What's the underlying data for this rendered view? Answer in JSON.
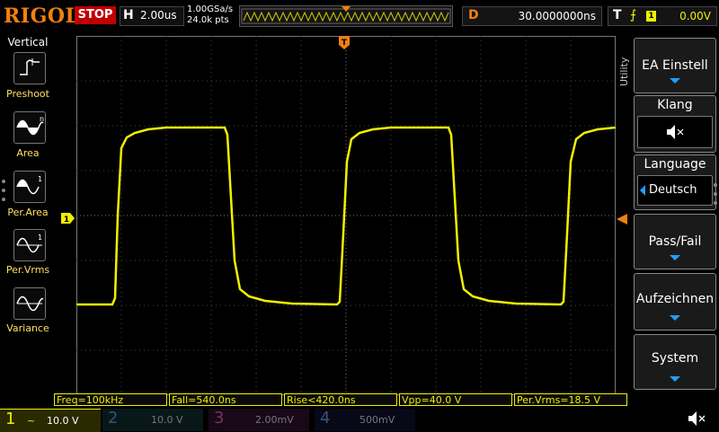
{
  "brand": "RIGOL",
  "run_state": "STOP",
  "horizontal": {
    "key": "H",
    "timebase": "2.00us"
  },
  "acquisition": {
    "sample_rate": "1.00GSa/s",
    "points": "24.0k pts"
  },
  "delay": {
    "key": "D",
    "value": "30.0000000ns"
  },
  "trigger": {
    "key": "T",
    "edge": "⨍",
    "source": "1",
    "level": "0.00V"
  },
  "markers": {
    "trigger_top": "T",
    "ch1_marker": "1"
  },
  "left_menu": {
    "title": "Vertical",
    "items": [
      {
        "label": "Preshoot",
        "icon": "preshoot-icon"
      },
      {
        "label": "Area",
        "icon": "area-icon"
      },
      {
        "label": "Per.Area",
        "icon": "per-area-icon"
      },
      {
        "label": "Per.Vrms",
        "icon": "per-vrms-icon"
      },
      {
        "label": "Variance",
        "icon": "variance-icon"
      }
    ]
  },
  "right_menu": {
    "side_label": "Utility",
    "ea_einstell": "EA Einstell",
    "klang": "Klang",
    "language_label": "Language",
    "language_value": "Deutsch",
    "pass_fail": "Pass/Fail",
    "aufzeichnen": "Aufzeichnen",
    "system": "System"
  },
  "measurements": [
    "Freq=100kHz",
    "Fall=540.0ns",
    "Rise<420.0ns",
    "Vpp=40.0 V",
    "Per.Vrms=18.5 V"
  ],
  "channels": [
    {
      "num": "1",
      "coupling": "~",
      "scale": "10.0 V",
      "color": "#f0f000"
    },
    {
      "num": "2",
      "scale": "10.0 V",
      "color": "#00c0c0"
    },
    {
      "num": "3",
      "scale": "2.00mV",
      "color": "#d020d0"
    },
    {
      "num": "4",
      "scale": "500mV",
      "color": "#2060ff"
    }
  ],
  "colors": {
    "ch1": "#f0f000",
    "accent": "#f08010",
    "stop": "#c00000",
    "menu_arrow": "#1ea0ff"
  }
}
